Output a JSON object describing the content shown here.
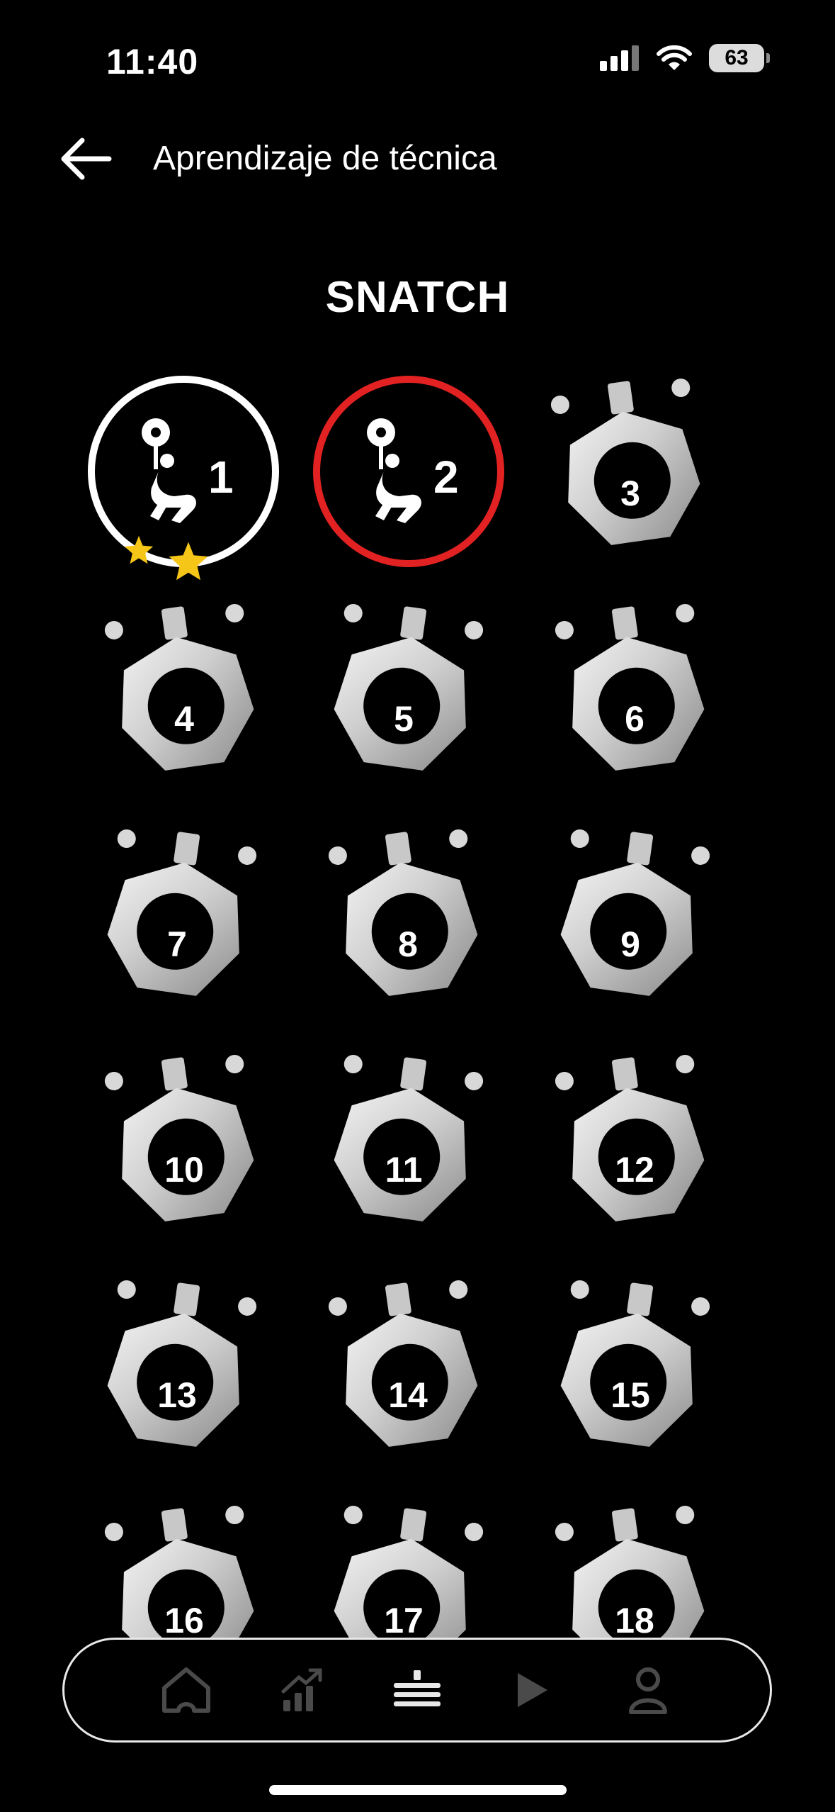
{
  "status_bar": {
    "time": "11:40",
    "battery": "63"
  },
  "header": {
    "title": "Aprendizaje de técnica",
    "back_icon": "arrow-left-icon"
  },
  "section": {
    "title": "SNATCH"
  },
  "levels": [
    {
      "label": "1",
      "state": "completed",
      "stars": 2
    },
    {
      "label": "2",
      "state": "current"
    },
    {
      "label": "3",
      "state": "locked"
    },
    {
      "label": "4",
      "state": "locked"
    },
    {
      "label": "5",
      "state": "locked"
    },
    {
      "label": "6",
      "state": "locked"
    },
    {
      "label": "7",
      "state": "locked"
    },
    {
      "label": "8",
      "state": "locked"
    },
    {
      "label": "9",
      "state": "locked"
    },
    {
      "label": "10",
      "state": "locked"
    },
    {
      "label": "11",
      "state": "locked"
    },
    {
      "label": "12",
      "state": "locked"
    },
    {
      "label": "13",
      "state": "locked"
    },
    {
      "label": "14",
      "state": "locked"
    },
    {
      "label": "15",
      "state": "locked"
    },
    {
      "label": "16",
      "state": "locked"
    },
    {
      "label": "17",
      "state": "locked"
    },
    {
      "label": "18",
      "state": "locked"
    }
  ],
  "bottom_nav": [
    {
      "icon": "home-icon"
    },
    {
      "icon": "stats-icon"
    },
    {
      "icon": "levels-icon",
      "active": true
    },
    {
      "icon": "play-icon"
    },
    {
      "icon": "profile-icon"
    }
  ],
  "colors": {
    "background": "#000000",
    "current_ring": "#e22222",
    "star": "#f5c518",
    "active_nav": "#e8e8e8",
    "inactive_nav": "#4a4a4a"
  }
}
